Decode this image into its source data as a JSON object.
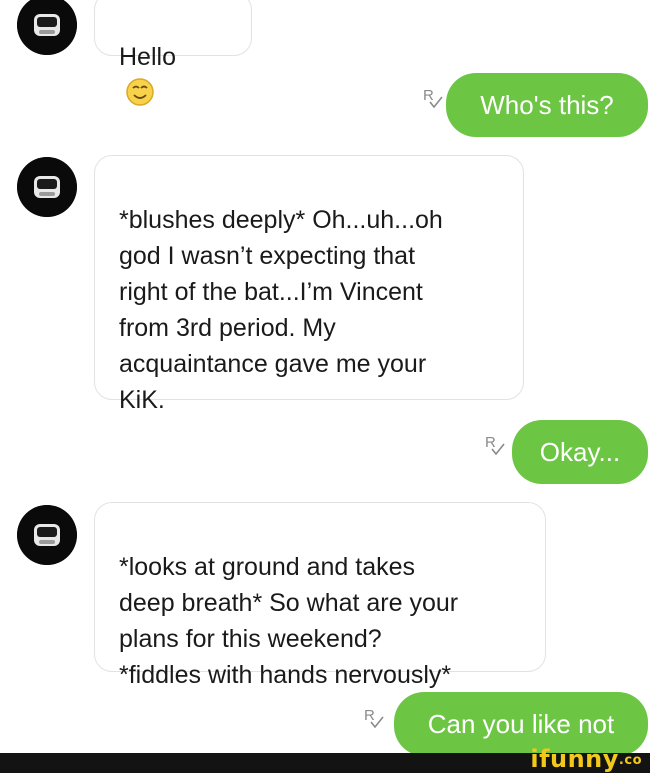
{
  "messages": [
    {
      "from": "them",
      "text": "Hello",
      "emoji": "smiling-face-icon"
    },
    {
      "from": "me",
      "text": "Who's this?",
      "receipt": "R"
    },
    {
      "from": "them",
      "text": "*blushes deeply* Oh...uh...oh\ngod I wasn’t expecting that\nright of the bat...I’m Vincent\nfrom 3rd period. My\nacquaintance gave me your\nKiK."
    },
    {
      "from": "me",
      "text": "Okay...",
      "receipt": "R"
    },
    {
      "from": "them",
      "text": "*looks at ground and takes\ndeep breath* So what are your\nplans for this weekend?\n*fiddles with hands nervously*"
    },
    {
      "from": "me",
      "text": "Can you like not",
      "receipt": "R"
    }
  ],
  "watermark": {
    "text": "ifunny",
    "suffix": ".co"
  },
  "colors": {
    "outgoing_bubble": "#6cc644",
    "incoming_border": "#e2e2e2",
    "avatar_bg": "#0a0a0a",
    "watermark": "#f2c81d"
  }
}
